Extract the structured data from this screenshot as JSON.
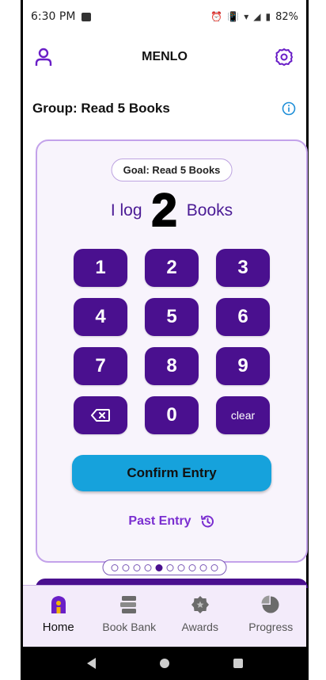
{
  "status_bar": {
    "time": "6:30 PM",
    "battery": "82%"
  },
  "header": {
    "title": "MENLO"
  },
  "group": {
    "title": "Group: Read 5 Books"
  },
  "card": {
    "goal_label": "Goal: Read 5 Books",
    "log_prefix": "I log",
    "log_value": "2",
    "log_suffix": "Books",
    "keys": [
      "1",
      "2",
      "3",
      "4",
      "5",
      "6",
      "7",
      "8",
      "9",
      "backspace",
      "0",
      "clear"
    ],
    "clear_label": "clear",
    "confirm_label": "Confirm Entry",
    "past_entry_label": "Past Entry"
  },
  "pager": {
    "count": 10,
    "active_index": 4
  },
  "bottom_nav": {
    "items": [
      {
        "label": "Home",
        "icon": "home-icon",
        "active": true
      },
      {
        "label": "Book Bank",
        "icon": "books-icon",
        "active": false
      },
      {
        "label": "Awards",
        "icon": "award-icon",
        "active": false
      },
      {
        "label": "Progress",
        "icon": "pie-chart-icon",
        "active": false
      }
    ]
  },
  "colors": {
    "primary": "#4a108f",
    "accent": "#7a2ed0",
    "confirm": "#16a2dc",
    "card_bg": "#f8f4fc",
    "card_border": "#c3a2ea",
    "nav_bg": "#f3ebfa"
  }
}
